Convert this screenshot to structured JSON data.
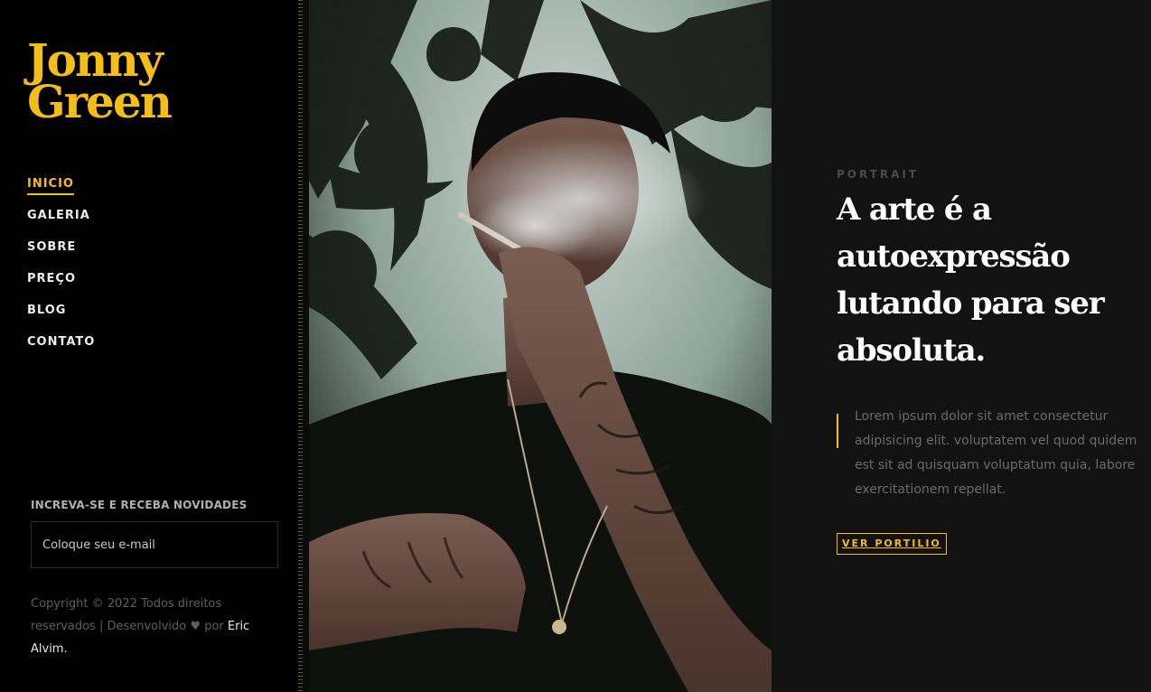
{
  "brand": {
    "line1": "Jonny",
    "line2": "Green",
    "color": "#f5bd17"
  },
  "nav": {
    "items": [
      {
        "label": "INICIO",
        "active": true
      },
      {
        "label": "GALERIA",
        "active": false
      },
      {
        "label": "SOBRE",
        "active": false
      },
      {
        "label": "PREÇO",
        "active": false
      },
      {
        "label": "BLOG",
        "active": false
      },
      {
        "label": "CONTATO",
        "active": false
      }
    ]
  },
  "newsletter": {
    "title": "INCREVA-SE E RECEBA NOVIDADES",
    "placeholder": "Coloque seu e-mail"
  },
  "footer": {
    "text_before": "Copyright © 2022 Todos direitos reservados | Desenvolvido",
    "heart_icon": "heart-icon",
    "text_by": "por",
    "author": "Eric Alvim."
  },
  "hero": {
    "eyebrow": "PORTRAIT",
    "headline": "A arte é a autoexpressão lutando para ser absoluta.",
    "quote": "Lorem ipsum dolor sit amet consectetur adipisicing elit. voluptatem vel quod quidem est sit ad quisquam voluptatum quia, labore exercitationem repellat.",
    "cta_label": "VER PORTILIO"
  },
  "colors": {
    "accent": "#f5bd17",
    "sidebar_bg": "#000000",
    "main_bg": "#121212"
  }
}
